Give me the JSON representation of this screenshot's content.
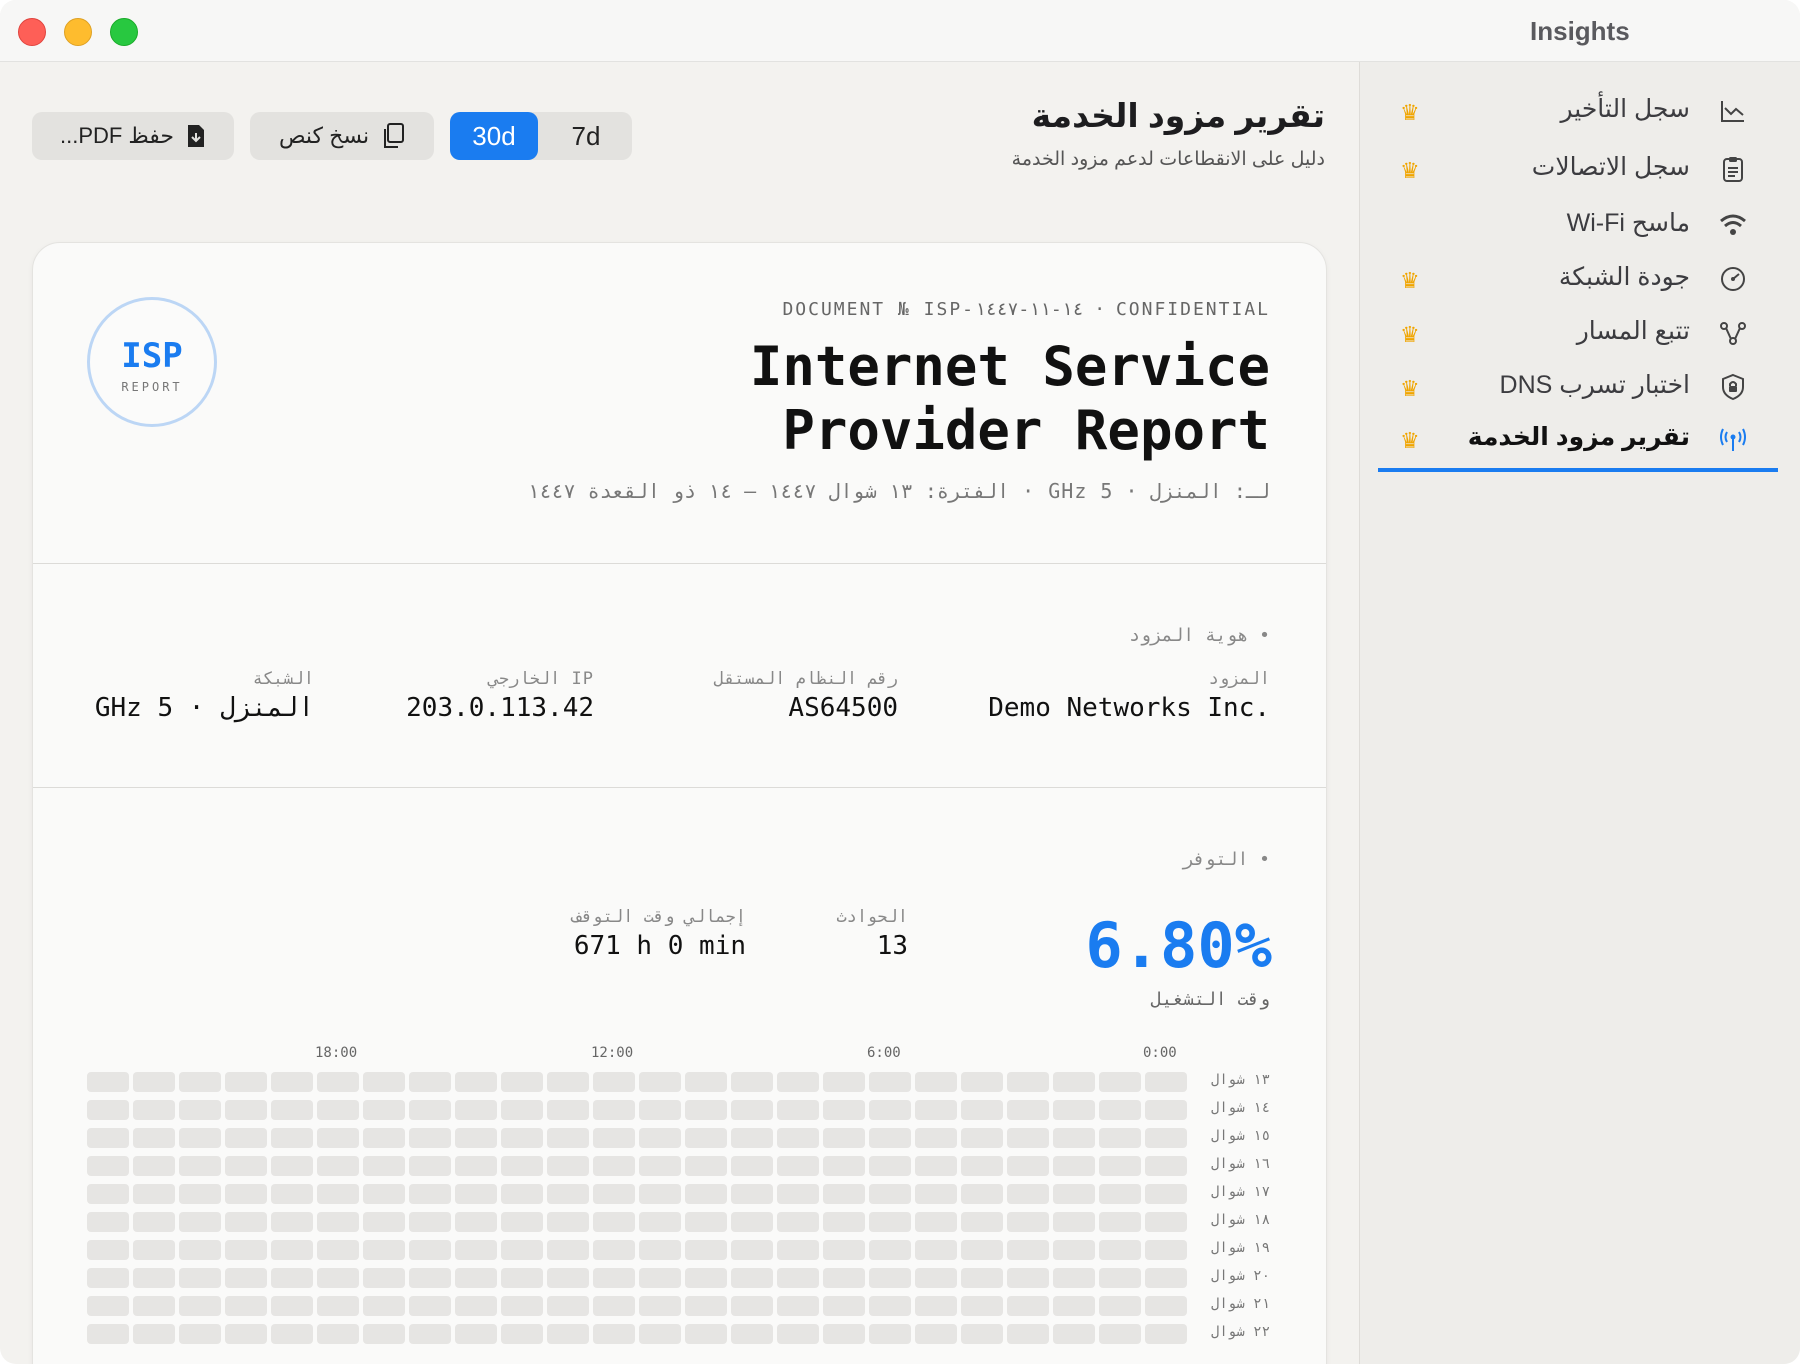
{
  "window": {
    "title": "Insights"
  },
  "sidebar": {
    "items": [
      {
        "label": "سجل التأخير",
        "icon": "chart-icon",
        "premium": true
      },
      {
        "label": "سجل الاتصالات",
        "icon": "clipboard-icon",
        "premium": true
      },
      {
        "label": "ماسح Wi-Fi",
        "icon": "wifi-icon",
        "premium": false
      },
      {
        "label": "جودة الشبكة",
        "icon": "gauge-icon",
        "premium": true
      },
      {
        "label": "تتبع المسار",
        "icon": "route-icon",
        "premium": true
      },
      {
        "label": "اختبار تسرب DNS",
        "icon": "shield-icon",
        "premium": true
      },
      {
        "label": "تقرير مزود الخدمة",
        "icon": "antenna-icon",
        "premium": true,
        "active": true
      }
    ]
  },
  "header": {
    "title": "تقرير مزود الخدمة",
    "subtitle": "دليل على الانقطاعات لدعم مزود الخدمة"
  },
  "toolbar": {
    "pdf_label": "حفظ PDF...",
    "copy_label": "نسخ كنص",
    "range_options": [
      "30d",
      "7d"
    ],
    "selected_range": "30d"
  },
  "report": {
    "meta": "DOCUMENT № ISP-١٤-١١-١٤٤٧ · CONFIDENTIAL",
    "title_line1": "Internet Service",
    "title_line2": "Provider Report",
    "period": "لـ: المنزل · GHz 5 · الفترة: ١٣ شوال ١٤٤٧ — ١٤ ذو القعدة ١٤٤٧",
    "logo_text": "ISP",
    "logo_sub": "REPORT",
    "identity": {
      "section": "• هوية المزود",
      "provider_label": "المزود",
      "provider_value": "Demo Networks Inc.",
      "asn_label": "رقم النظام المستقل",
      "asn_value": "AS64500",
      "ip_label": "IP الخارجي",
      "ip_value": "203.0.113.42",
      "network_label": "الشبكة",
      "network_value": "المنزل · GHz 5"
    },
    "availability": {
      "section": "• التوفر",
      "uptime_value": "6.80%",
      "uptime_label": "وقت التشغيل",
      "incidents_label": "الحوادث",
      "incidents_value": "13",
      "downtime_label": "إجمالي وقت التوقف",
      "downtime_value": "671 h 0 min"
    },
    "heatmap": {
      "hour_labels": [
        "0:00",
        "6:00",
        "12:00",
        "18:00"
      ],
      "day_labels": [
        "١٣ شوال",
        "١٤ شوال",
        "١٥ شوال",
        "١٦ شوال",
        "١٧ شوال",
        "١٨ شوال",
        "١٩ شوال",
        "٢٠ شوال",
        "٢١ شوال",
        "٢٢ شوال"
      ],
      "cells_per_row": 24
    }
  },
  "colors": {
    "accent": "#1a7cf0",
    "crown": "#f0a500"
  }
}
